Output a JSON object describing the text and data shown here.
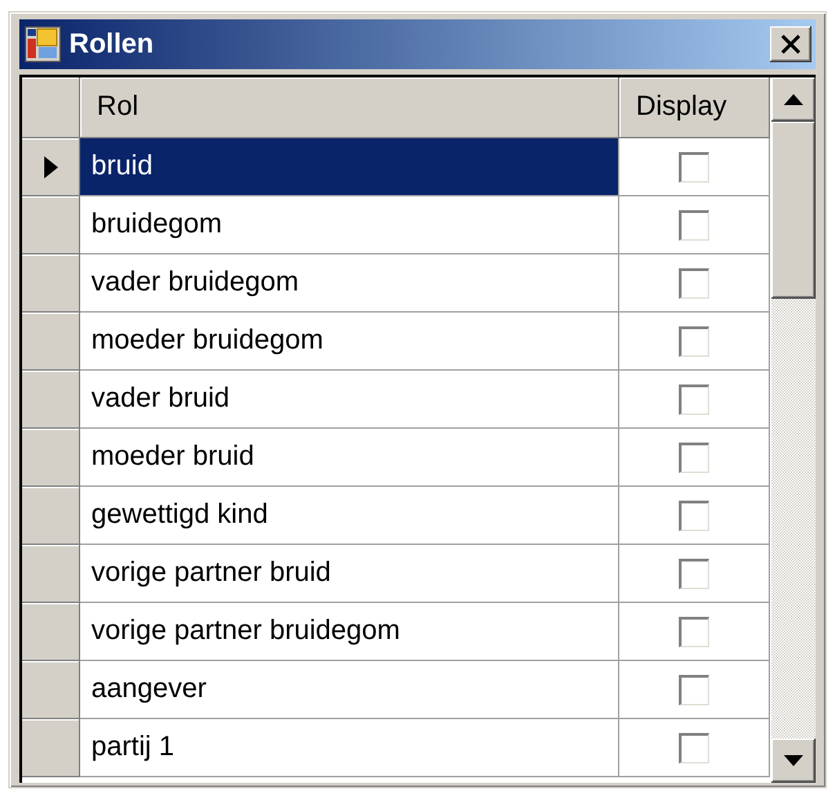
{
  "window": {
    "title": "Rollen"
  },
  "table": {
    "columns": [
      "Rol",
      "Display"
    ],
    "rows": [
      {
        "rol": "bruid",
        "display": false,
        "selected": true
      },
      {
        "rol": "bruidegom",
        "display": false,
        "selected": false
      },
      {
        "rol": "vader bruidegom",
        "display": false,
        "selected": false
      },
      {
        "rol": "moeder bruidegom",
        "display": false,
        "selected": false
      },
      {
        "rol": "vader bruid",
        "display": false,
        "selected": false
      },
      {
        "rol": "moeder bruid",
        "display": false,
        "selected": false
      },
      {
        "rol": "gewettigd kind",
        "display": false,
        "selected": false
      },
      {
        "rol": "vorige partner bruid",
        "display": false,
        "selected": false
      },
      {
        "rol": "vorige partner bruidegom",
        "display": false,
        "selected": false
      },
      {
        "rol": "aangever",
        "display": false,
        "selected": false
      },
      {
        "rol": "partij 1",
        "display": false,
        "selected": false
      }
    ]
  }
}
